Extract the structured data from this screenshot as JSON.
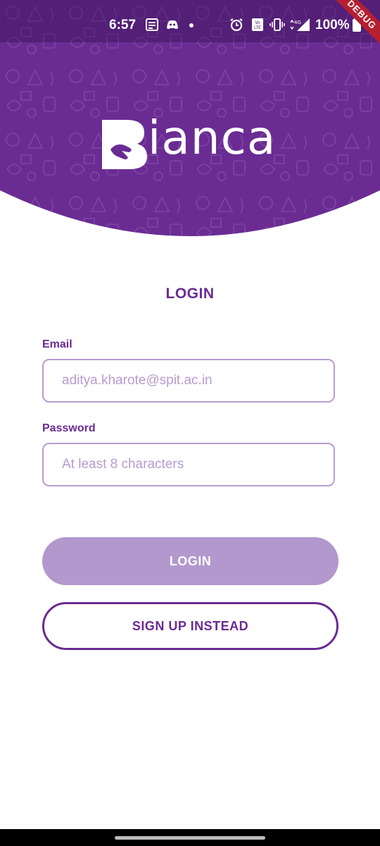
{
  "status_bar": {
    "time": "6:57",
    "battery": "100%",
    "debug_banner": "DEBUG",
    "icons": [
      "news-icon",
      "discord-icon",
      "dot-icon",
      "alarm-icon",
      "volte-icon",
      "vibrate-icon",
      "network-4g-icon",
      "signal-icon",
      "battery-icon"
    ]
  },
  "header": {
    "logo_initial": "B",
    "logo_text": "ianca",
    "colors": {
      "primary": "#6b2a91",
      "header_bg": "#6a2c93"
    }
  },
  "form": {
    "title": "LOGIN",
    "email": {
      "label": "Email",
      "placeholder": "aditya.kharote@spit.ac.in"
    },
    "password": {
      "label": "Password",
      "placeholder": "At least 8 characters"
    },
    "login_button": "LOGIN",
    "signup_button": "SIGN UP INSTEAD",
    "colors": {
      "login_button_bg": "#b298cc",
      "input_border": "#b89cd0"
    }
  }
}
